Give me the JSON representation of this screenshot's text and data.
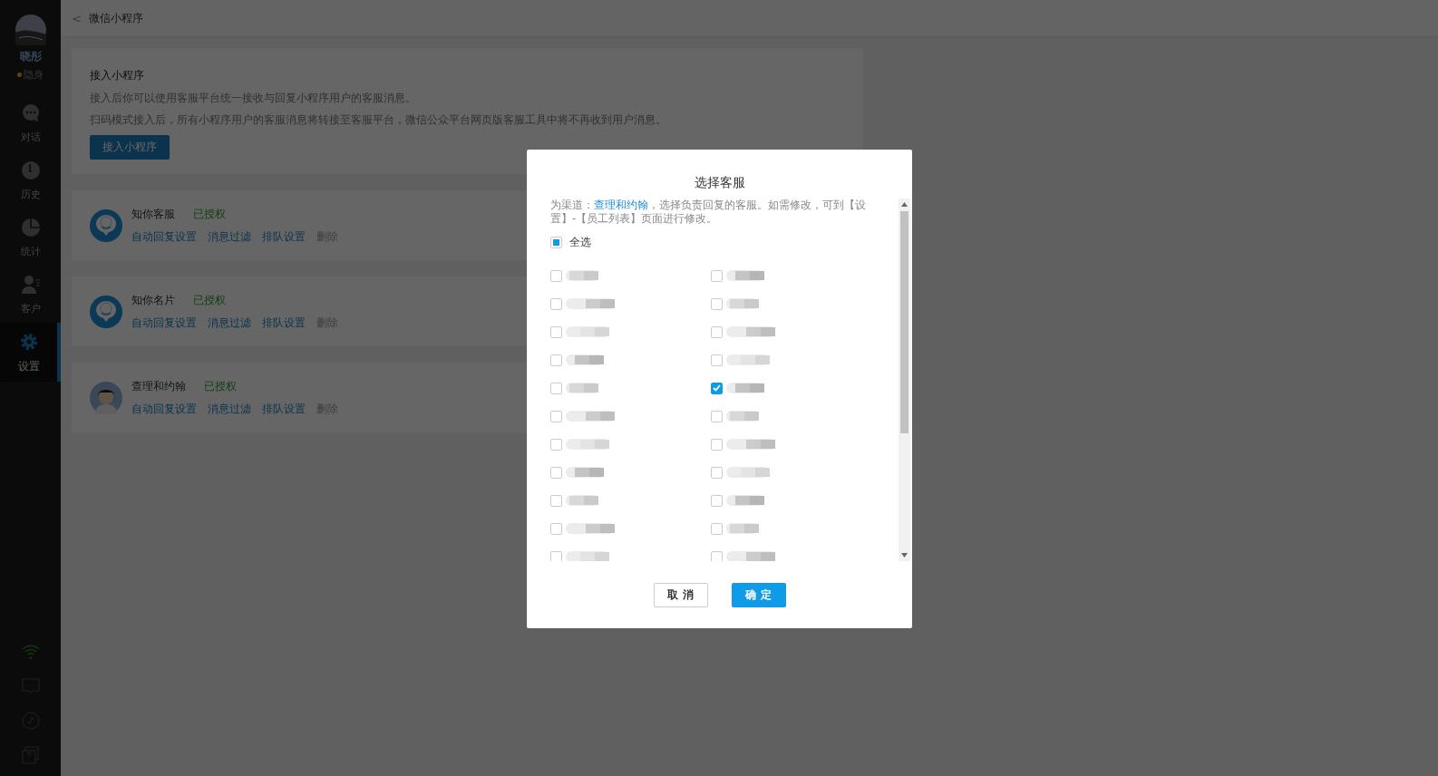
{
  "sidebar": {
    "user": {
      "name": "晓彤",
      "status": "隐身"
    },
    "items": [
      {
        "label": "对话",
        "selected": false
      },
      {
        "label": "历史",
        "selected": false
      },
      {
        "label": "统计",
        "selected": false
      },
      {
        "label": "客户",
        "selected": false
      },
      {
        "label": "设置",
        "selected": true
      }
    ]
  },
  "header": {
    "back": "<",
    "title": "微信小程序"
  },
  "intro": {
    "title": "接入小程序",
    "lines": [
      "接入后你可以使用客服平台统一接收与回复小程序用户的客服消息。",
      "扫码模式接入后，所有小程序用户的客服消息将转接至客服平台，微信公众平台网页版客服工具中将不再收到用户消息。"
    ],
    "button": "接入小程序"
  },
  "apps": [
    {
      "name": "知你客服",
      "status": "已授权",
      "actions": [
        "自动回复设置",
        "消息过滤",
        "排队设置",
        "删除"
      ]
    },
    {
      "name": "知你名片",
      "status": "已授权",
      "actions": [
        "自动回复设置",
        "消息过滤",
        "排队设置",
        "删除"
      ]
    },
    {
      "name": "查理和约翰",
      "status": "已授权",
      "actions": [
        "自动回复设置",
        "消息过滤",
        "排队设置",
        "删除"
      ]
    }
  ],
  "dialog": {
    "title": "选择客服",
    "description": "为渠道：**查理和约翰**，选择负责回复的客服。如需修改，可到【设置】-【员工列表】页面进行修改。",
    "select_all": {
      "label": "全选",
      "indeterminate": true
    },
    "agents": [
      {
        "checked": false
      },
      {
        "checked": false
      },
      {
        "checked": false
      },
      {
        "checked": false
      },
      {
        "checked": false
      },
      {
        "checked": false
      },
      {
        "checked": false
      },
      {
        "checked": false
      },
      {
        "checked": false
      },
      {
        "checked": false
      },
      {
        "checked": false
      },
      {
        "checked": false
      },
      {
        "checked": false
      },
      {
        "checked": false
      },
      {
        "checked": false
      },
      {
        "checked": true
      },
      {
        "checked": false
      },
      {
        "checked": false
      },
      {
        "checked": false
      },
      {
        "checked": false
      },
      {
        "checked": false
      },
      {
        "checked": false
      }
    ],
    "cancel": "取 消",
    "confirm": "确 定"
  }
}
